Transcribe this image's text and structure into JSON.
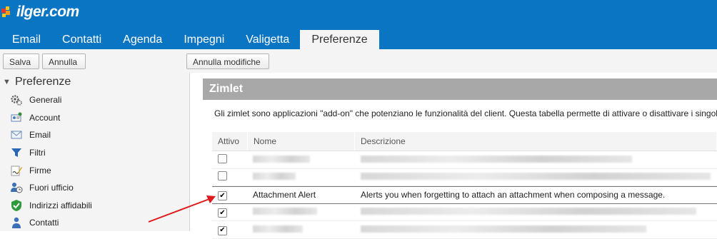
{
  "brand": {
    "logo_text": "ilger.com"
  },
  "tabs": [
    {
      "label": "Email"
    },
    {
      "label": "Contatti"
    },
    {
      "label": "Agenda"
    },
    {
      "label": "Impegni"
    },
    {
      "label": "Valigetta"
    },
    {
      "label": "Preferenze",
      "active": true
    }
  ],
  "toolbar": {
    "save_label": "Salva",
    "cancel_label": "Annulla",
    "undo_changes_label": "Annulla modifiche"
  },
  "sidebar": {
    "title": "Preferenze",
    "items": [
      {
        "label": "Generali",
        "icon": "gears-icon"
      },
      {
        "label": "Account",
        "icon": "account-icon"
      },
      {
        "label": "Email",
        "icon": "envelope-icon"
      },
      {
        "label": "Filtri",
        "icon": "filter-icon"
      },
      {
        "label": "Firme",
        "icon": "signature-pen-icon"
      },
      {
        "label": "Fuori ufficio",
        "icon": "out-of-office-icon"
      },
      {
        "label": "Indirizzi affidabili",
        "icon": "shield-check-icon"
      },
      {
        "label": "Contatti",
        "icon": "contact-person-icon"
      }
    ]
  },
  "main": {
    "section_title": "Zimlet",
    "description": "Gli zimlet sono applicazioni \"add-on\" che potenziano le funzionalità del client. Questa tabella permette di attivare o disattivare i singoli",
    "columns": {
      "active": "Attivo",
      "name": "Nome",
      "description": "Descrizione"
    },
    "rows": [
      {
        "checked": false,
        "name": "",
        "description": "",
        "redacted": true
      },
      {
        "checked": false,
        "name": "",
        "description": "",
        "redacted": true
      },
      {
        "checked": true,
        "name": "Attachment Alert",
        "description": "Alerts you when forgetting to attach an attachment when composing a message.",
        "redacted": false
      },
      {
        "checked": true,
        "name": "",
        "description": "",
        "redacted": true
      },
      {
        "checked": true,
        "name": "",
        "description": "",
        "redacted": true
      }
    ]
  },
  "colors": {
    "header_blue": "#0a75c2",
    "section_header_gray": "#a8a8a8",
    "annotation_arrow": "#e0191b"
  }
}
